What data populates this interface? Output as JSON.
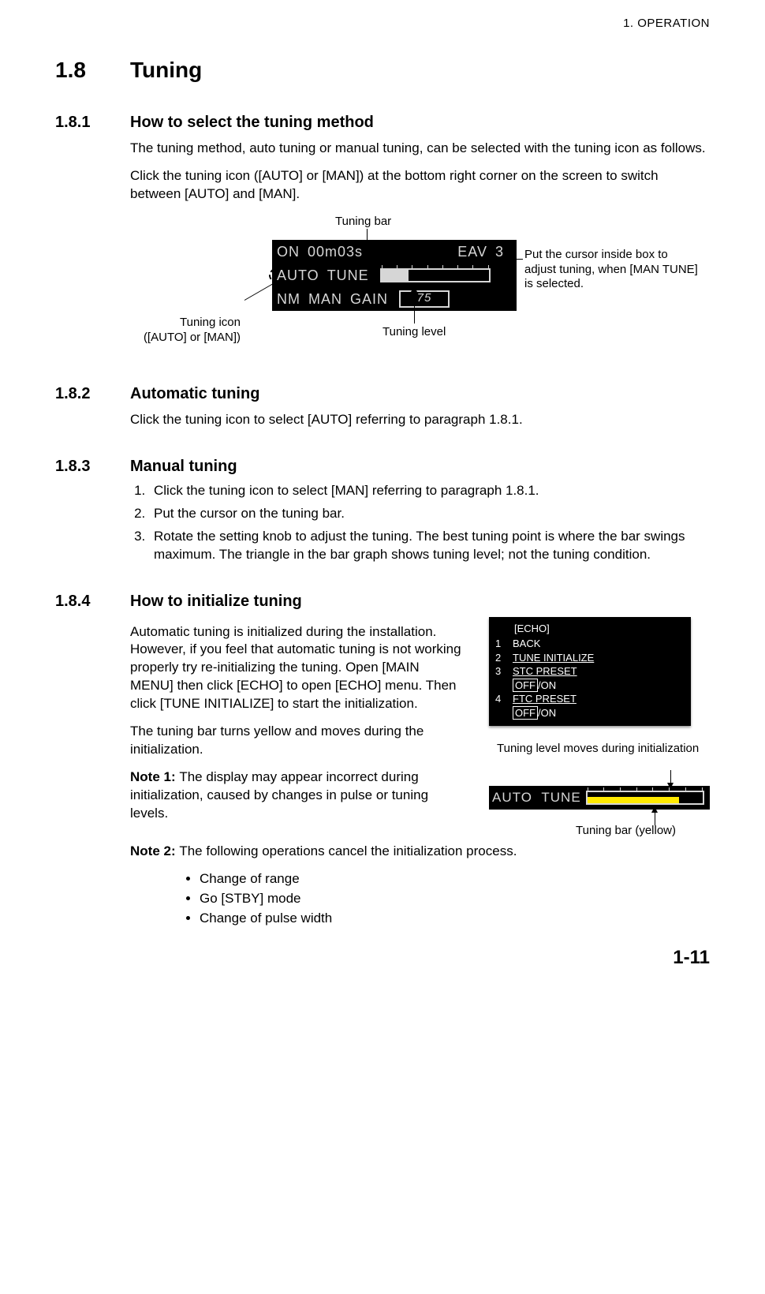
{
  "header": {
    "chapter": "1.  OPERATION"
  },
  "section": {
    "number": "1.8",
    "title": "Tuning"
  },
  "s181": {
    "number": "1.8.1",
    "title": "How to select the tuning method",
    "p1": "The tuning method, auto tuning or manual tuning, can be selected with the tuning icon as follows.",
    "p2": "Click the tuning icon ([AUTO] or [MAN]) at the bottom right corner on the screen to switch between [AUTO] and [MAN]."
  },
  "fig1": {
    "labels": {
      "tuning_bar": "Tuning bar",
      "cursor_box": "Put the cursor inside box to adjust tuning, when [MAN TUNE] is selected.",
      "tuning_icon_l1": "Tuning icon",
      "tuning_icon_l2": "([AUTO] or [MAN])",
      "tuning_level": "Tuning level"
    },
    "panel": {
      "r1_on": "ON",
      "r1_time": "00m03s",
      "r1_eav": "EAV",
      "r1_num": "3",
      "r2_mode": "AUTO",
      "r2_tune": "TUNE",
      "r3_nm": "NM",
      "r3_man": "MAN",
      "r3_gain": "GAIN",
      "r3_val": "75"
    }
  },
  "s182": {
    "number": "1.8.2",
    "title": "Automatic tuning",
    "p1": "Click the tuning icon to select [AUTO] referring to paragraph 1.8.1."
  },
  "s183": {
    "number": "1.8.3",
    "title": "Manual tuning",
    "steps": [
      "Click the tuning icon to select [MAN] referring to paragraph 1.8.1.",
      "Put the cursor on the tuning bar.",
      "Rotate the setting knob to adjust the tuning. The best tuning point is where the bar swings maximum. The triangle in the bar graph shows tuning level; not the tuning condition."
    ]
  },
  "s184": {
    "number": "1.8.4",
    "title": "How to initialize tuning",
    "p1": "Automatic tuning is initialized during the installation. However, if you feel that automatic tuning is not working properly try re-initializing the tuning. Open [MAIN MENU] then click [ECHO] to open [ECHO] menu. Then click [TUNE INITIALIZE] to start the initialization.",
    "p2": "The tuning bar turns yellow and moves during the initialization.",
    "note1_label": "Note 1: ",
    "note1": "The display may appear incorrect during initialization, caused by changes in pulse or tuning levels.",
    "note2_label": "Note 2: ",
    "note2": "The following operations cancel the initialization process.",
    "bullets": [
      "Change of range",
      "Go [STBY] mode",
      "Change of pulse width"
    ],
    "echo": {
      "title": "[ECHO]",
      "items": [
        {
          "n": "1",
          "t": "BACK"
        },
        {
          "n": "2",
          "t": "TUNE INITIALIZE"
        },
        {
          "n": "3",
          "t": "STC PRESET",
          "opt_off": "OFF",
          "opt_on": "/ON"
        },
        {
          "n": "4",
          "t": "FTC PRESET",
          "opt_off": "OFF",
          "opt_on": "/ON"
        }
      ]
    },
    "init_labels": {
      "top": "Tuning level moves during initialization",
      "bottom": "Tuning bar (yellow)"
    },
    "init_panel": {
      "mode": "AUTO",
      "tune": "TUNE"
    }
  },
  "page_number": "1-11"
}
